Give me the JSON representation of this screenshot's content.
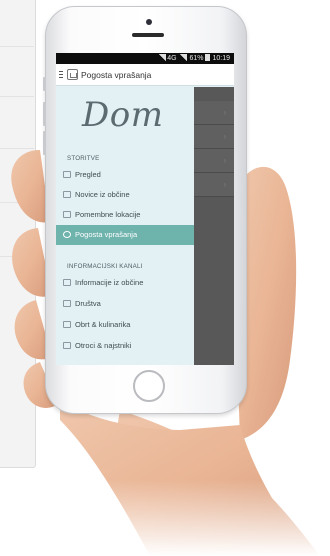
{
  "status_bar": {
    "network": "4G",
    "battery": "61%",
    "time": "10:19"
  },
  "app_bar": {
    "title": "Pogosta vprašanja"
  },
  "drawer": {
    "logo": "Dom",
    "section_storitve": "STORITVE",
    "storitve_items": [
      {
        "label": "Pregled",
        "icon": "home-icon"
      },
      {
        "label": "Novice iz občine",
        "icon": "news-icon"
      },
      {
        "label": "Pomembne lokacije",
        "icon": "map-icon"
      },
      {
        "label": "Pogosta vprašanja",
        "icon": "question-icon",
        "active": true
      }
    ],
    "section_info": "INFORMACIJSKI KANALI",
    "info_items": [
      {
        "label": "Informacije iz občine",
        "icon": "building-icon"
      },
      {
        "label": "Društva",
        "icon": "group-icon"
      },
      {
        "label": "Obrt & kulinarika",
        "icon": "cutlery-icon"
      },
      {
        "label": "Otroci & najstniki",
        "icon": "children-icon"
      }
    ]
  },
  "behind_rows": [
    "›",
    "›",
    "›",
    "›"
  ],
  "colors": {
    "accent": "#6fb3ad",
    "drawer_bg": "#e3f1f5",
    "overlay": "#585858"
  }
}
